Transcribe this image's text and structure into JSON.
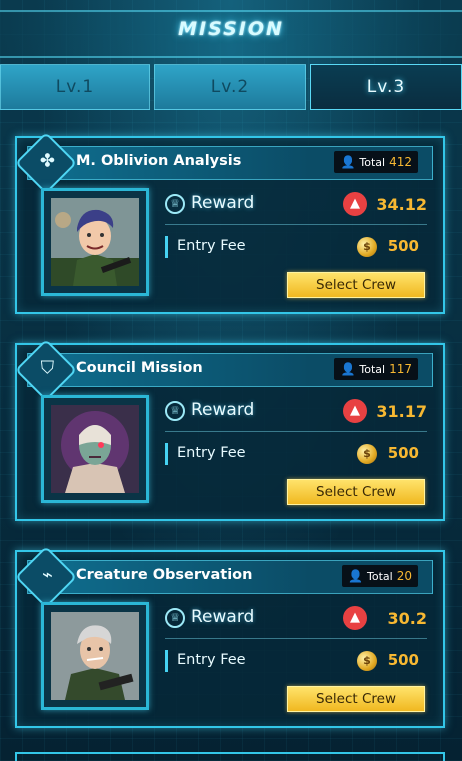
{
  "header": {
    "title": "MISSION"
  },
  "tabs": [
    {
      "label": "Lv.1",
      "active": false
    },
    {
      "label": "Lv.2",
      "active": false
    },
    {
      "label": "Lv.3",
      "active": true
    }
  ],
  "labels": {
    "reward": "Reward",
    "entry_fee": "Entry Fee",
    "total": "Total",
    "select_crew": "Select Crew"
  },
  "colors": {
    "accent": "#33c6e8",
    "value": "#f7b832",
    "button": "#f0b820",
    "avax": "#e84142"
  },
  "missions": [
    {
      "name": "M. Oblivion Analysis",
      "icon": "clover-icon",
      "total": "412",
      "reward": "34.12",
      "reward_currency_icon": "avax-icon",
      "entry_fee": "500",
      "fee_currency_icon": "coin-icon"
    },
    {
      "name": "Council Mission",
      "icon": "emblem-icon",
      "total": "117",
      "reward": "31.17",
      "reward_currency_icon": "avax-icon",
      "entry_fee": "500",
      "fee_currency_icon": "coin-icon"
    },
    {
      "name": "Creature Observation",
      "icon": "boot-icon",
      "total": "20",
      "reward": "30.2",
      "reward_currency_icon": "avax-icon",
      "entry_fee": "500",
      "fee_currency_icon": "coin-icon"
    }
  ]
}
